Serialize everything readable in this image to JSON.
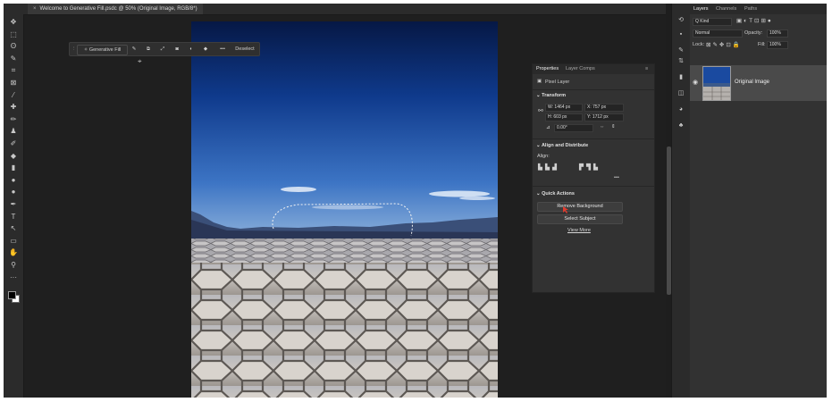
{
  "document": {
    "tab_title": "Welcome to Generative Fill.psdc @ 50% (Original Image, RGB/8*)",
    "close_glyph": "×"
  },
  "tools": [
    {
      "name": "move-tool-icon",
      "glyph": "✥"
    },
    {
      "name": "artboard-tool-icon",
      "glyph": "⬚"
    },
    {
      "name": "lasso-tool-icon",
      "glyph": "ʘ"
    },
    {
      "name": "quick-selection-tool-icon",
      "glyph": "✎"
    },
    {
      "name": "crop-tool-icon",
      "glyph": "⌗"
    },
    {
      "name": "frame-tool-icon",
      "glyph": "⊠"
    },
    {
      "name": "eyedropper-tool-icon",
      "glyph": "⁄"
    },
    {
      "name": "healing-brush-tool-icon",
      "glyph": "✚"
    },
    {
      "name": "brush-tool-icon",
      "glyph": "✏"
    },
    {
      "name": "clone-stamp-tool-icon",
      "glyph": "♟"
    },
    {
      "name": "history-brush-tool-icon",
      "glyph": "✐"
    },
    {
      "name": "eraser-tool-icon",
      "glyph": "◆"
    },
    {
      "name": "gradient-tool-icon",
      "glyph": "▮"
    },
    {
      "name": "blur-tool-icon",
      "glyph": "●"
    },
    {
      "name": "dodge-tool-icon",
      "glyph": "●"
    },
    {
      "name": "pen-tool-icon",
      "glyph": "✒"
    },
    {
      "name": "type-tool-icon",
      "glyph": "T"
    },
    {
      "name": "path-selection-tool-icon",
      "glyph": "↖"
    },
    {
      "name": "rectangle-tool-icon",
      "glyph": "▭"
    },
    {
      "name": "hand-tool-icon",
      "glyph": "✋"
    },
    {
      "name": "zoom-tool-icon",
      "glyph": "⚲"
    },
    {
      "name": "more-tools-icon",
      "glyph": "···"
    }
  ],
  "contextual_taskbar": {
    "generative_fill_label": "Generative Fill",
    "deselect_label": "Deselect",
    "more_glyph": "•••"
  },
  "properties": {
    "tab_properties": "Properties",
    "tab_layer_comps": "Layer Comps",
    "layer_kind": "Pixel Layer",
    "transform_title": "Transform",
    "w_label": "W:",
    "w_value": "1464 px",
    "x_label": "X:",
    "x_value": "757 px",
    "h_label": "H:",
    "h_value": "603 px",
    "y_label": "Y:",
    "y_value": "1712 px",
    "angle_value": "0.00°",
    "align_title": "Align and Distribute",
    "align_label": "Align:",
    "more_glyph": "•••",
    "quick_actions_title": "Quick Actions",
    "remove_background": "Remove Background",
    "select_subject": "Select Subject",
    "view_more": "View More"
  },
  "layers_panel": {
    "tab_layers": "Layers",
    "tab_channels": "Channels",
    "tab_paths": "Paths",
    "kind_filter": "Q Kind",
    "blend_mode": "Normal",
    "opacity_label": "Opacity:",
    "opacity_value": "100%",
    "lock_label": "Lock:",
    "fill_label": "Fill:",
    "fill_value": "100%",
    "layer_name": "Original Image"
  },
  "colors": {
    "accent_blue": "#2f6fd8",
    "cursor_red": "#e23b2e",
    "sky_top": "#071a52",
    "sky_bottom": "#5f96d8"
  }
}
